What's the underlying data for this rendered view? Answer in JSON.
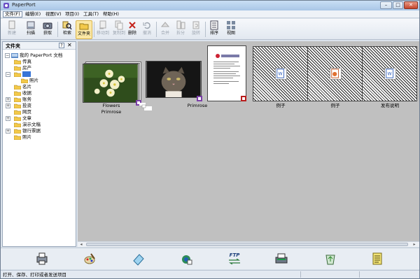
{
  "window": {
    "title": "PaperPort",
    "controls": {
      "minimize": "–",
      "maximize": "□",
      "close": "✕"
    }
  },
  "menu": [
    "文件(F)",
    "编辑(E)",
    "视图(V)",
    "项目(I)",
    "工具(T)",
    "帮助(H)"
  ],
  "toolbar": {
    "new": "新建",
    "scan": "扫描",
    "get": "获取",
    "search": "检索",
    "folders": "文件夹",
    "move_to": "移动到",
    "copy_to": "复制到",
    "delete": "删除",
    "undo": "撤消",
    "merge": "合并",
    "split": "拆分",
    "rotate": "旋转",
    "sort": "排序",
    "view": "视图"
  },
  "folder_pane": {
    "title": "文件夹",
    "help": "?",
    "close": "✕",
    "root": "我的 PaperPort 文档",
    "items": [
      {
        "label": "传真",
        "expander": ""
      },
      {
        "label": "房产",
        "expander": ""
      },
      {
        "label": "",
        "expander": "−",
        "selected": true
      },
      {
        "label": "照片",
        "expander": ""
      },
      {
        "label": "名片",
        "expander": ""
      },
      {
        "label": "收据",
        "expander": ""
      },
      {
        "label": "账务",
        "expander": "+"
      },
      {
        "label": "投资",
        "expander": "+"
      },
      {
        "label": "网页",
        "expander": ""
      },
      {
        "label": "文章",
        "expander": "+"
      },
      {
        "label": "演示文稿",
        "expander": ""
      },
      {
        "label": "银行票据",
        "expander": "+"
      },
      {
        "label": "照片",
        "expander": ""
      }
    ]
  },
  "thumbnails": [
    {
      "caption1": "Flowers",
      "caption2": "Primrose"
    },
    {
      "caption1": "Primrose",
      "caption2": ""
    },
    {
      "caption1": "",
      "caption2": ""
    },
    {
      "caption1": "例子",
      "caption2": ""
    },
    {
      "caption1": "例子",
      "caption2": ""
    },
    {
      "caption1": "发布说明",
      "caption2": ""
    }
  ],
  "sendto_icons": [
    "printer-icon",
    "paint-icon",
    "notepad-icon",
    "internet-explorer-icon",
    "ftp-icon",
    "printer2-icon",
    "recycle-icon",
    "text-doc-icon"
  ],
  "ftp_label": "FTP",
  "status": "打开、保存、打印或者发送项目",
  "colors": {
    "content_bg": "#c0c0c0",
    "select": "#3875d7"
  }
}
